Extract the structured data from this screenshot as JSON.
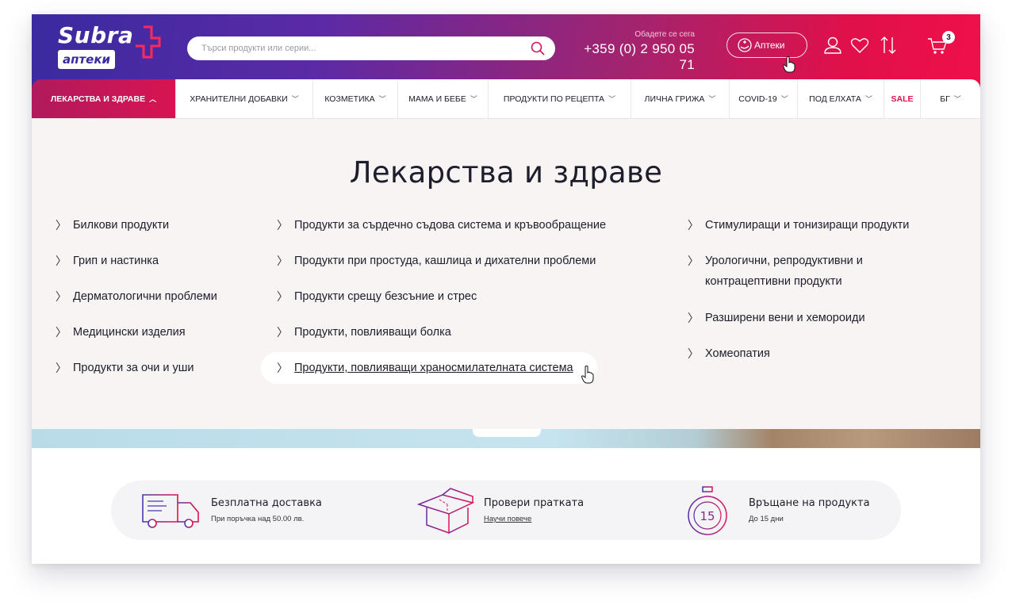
{
  "brand": {
    "logo_top": "Subra",
    "logo_bottom": "аптеки"
  },
  "search": {
    "placeholder": "Търси продукти или серии..."
  },
  "contact": {
    "label": "Обадете се сега",
    "phone": "+359 (0) 2 950 05 71"
  },
  "pharmacies_button": "Аптеки",
  "cart": {
    "count": "3"
  },
  "nav": {
    "items": [
      {
        "label": "ЛЕКАРСТВА И ЗДРАВЕ",
        "chevron": "︿",
        "active": true
      },
      {
        "label": "ХРАНИТЕЛНИ ДОБАВКИ",
        "chevron": "﹀"
      },
      {
        "label": "КОЗМЕТИКА",
        "chevron": "﹀"
      },
      {
        "label": "МАМА И БЕБЕ",
        "chevron": "﹀"
      },
      {
        "label": "ПРОДУКТИ ПО РЕЦЕПТА",
        "chevron": "﹀"
      },
      {
        "label": "ЛИЧНА ГРИЖА",
        "chevron": "﹀"
      },
      {
        "label": "COVID-19",
        "chevron": "﹀"
      },
      {
        "label": "ПОД ЕЛХАТА",
        "chevron": "﹀"
      },
      {
        "label": "SALE"
      },
      {
        "label": "БГ",
        "chevron": "﹀"
      }
    ]
  },
  "menu": {
    "title": "Лекарства и здраве",
    "arrow": "〉",
    "col1": [
      "Билкови продукти",
      "Грип и настинка",
      "Дерматологични проблеми",
      "Медицински изделия",
      "Продукти за очи и уши"
    ],
    "col2": [
      "Продукти за сърдечно съдова система и кръвообращение",
      "Продукти при простуда, кашлица и дихателни проблеми",
      "Продукти срещу безсъние и стрес",
      "Продукти, повлияващи болка",
      "Продукти, повлияващи храносмилателната система"
    ],
    "col3": [
      "Стимулиращи и тонизиращи продукти",
      "Урологични, репродуктивни и",
      "контрацептивни продукти",
      "Разширени вени и хемороиди",
      "Хомеопатия"
    ]
  },
  "features": [
    {
      "title": "Безплатна доставка",
      "sub": "При поръчка над 50.00 лв.",
      "icon": "truck-icon"
    },
    {
      "title": "Провери пратката",
      "sub": "Научи повече",
      "icon": "box-icon"
    },
    {
      "title": "Връщане на продукта",
      "sub": "До 15 дни",
      "icon": "stopwatch-icon",
      "badge": "15"
    }
  ],
  "colors": {
    "accent": "#e0104a",
    "brand_purple": "#3a2aa0",
    "menu_bg": "#f8f4f3"
  }
}
